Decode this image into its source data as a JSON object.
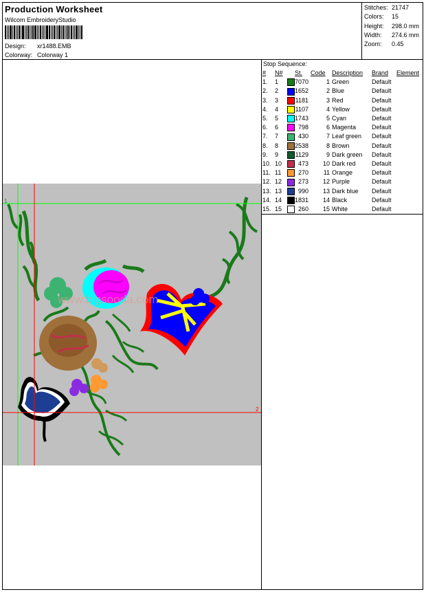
{
  "header": {
    "title": "Production Worksheet",
    "software": "Wilcom EmbroideryStudio",
    "design_label": "Design:",
    "design_value": "xr1488.EMB",
    "colorway_label": "Colorway:",
    "colorway_value": "Colorway 1"
  },
  "stats": {
    "stitches_label": "Stitches:",
    "stitches": "21747",
    "colors_label": "Colors:",
    "colors": "15",
    "height_label": "Height:",
    "height": "298.0 mm",
    "width_label": "Width:",
    "width": "274.6 mm",
    "zoom_label": "Zoom:",
    "zoom": "0.45"
  },
  "stop_sequence": {
    "title": "Stop Sequence:",
    "headers": [
      "#",
      "N#",
      "St.",
      "Code",
      "Description",
      "Brand",
      "Element"
    ],
    "rows": [
      {
        "n": "1.",
        "nn": "1",
        "color": "#1a7a1a",
        "st": "7070",
        "code": "1",
        "desc": "Green",
        "brand": "Default"
      },
      {
        "n": "2.",
        "nn": "2",
        "color": "#0000ff",
        "st": "1652",
        "code": "2",
        "desc": "Blue",
        "brand": "Default"
      },
      {
        "n": "3.",
        "nn": "3",
        "color": "#ff0000",
        "st": "1181",
        "code": "3",
        "desc": "Red",
        "brand": "Default"
      },
      {
        "n": "4.",
        "nn": "4",
        "color": "#ffff00",
        "st": "1107",
        "code": "4",
        "desc": "Yellow",
        "brand": "Default"
      },
      {
        "n": "5.",
        "nn": "5",
        "color": "#00ffff",
        "st": "1743",
        "code": "5",
        "desc": "Cyan",
        "brand": "Default"
      },
      {
        "n": "6.",
        "nn": "6",
        "color": "#ff00ff",
        "st": "798",
        "code": "6",
        "desc": "Magenta",
        "brand": "Default"
      },
      {
        "n": "7.",
        "nn": "7",
        "color": "#3cb371",
        "st": "430",
        "code": "7",
        "desc": "Leaf green",
        "brand": "Default"
      },
      {
        "n": "8.",
        "nn": "8",
        "color": "#a0703a",
        "st": "2538",
        "code": "8",
        "desc": "Brown",
        "brand": "Default"
      },
      {
        "n": "9.",
        "nn": "9",
        "color": "#0f5a2e",
        "st": "1129",
        "code": "9",
        "desc": "Dark green",
        "brand": "Default"
      },
      {
        "n": "10.",
        "nn": "10",
        "color": "#c0304a",
        "st": "473",
        "code": "10",
        "desc": "Dark red",
        "brand": "Default"
      },
      {
        "n": "11.",
        "nn": "11",
        "color": "#ff9933",
        "st": "270",
        "code": "11",
        "desc": "Orange",
        "brand": "Default"
      },
      {
        "n": "12.",
        "nn": "12",
        "color": "#8a2be2",
        "st": "273",
        "code": "12",
        "desc": "Purple",
        "brand": "Default"
      },
      {
        "n": "13.",
        "nn": "13",
        "color": "#1c3f94",
        "st": "990",
        "code": "13",
        "desc": "Dark blue",
        "brand": "Default"
      },
      {
        "n": "14.",
        "nn": "14",
        "color": "#000000",
        "st": "1831",
        "code": "14",
        "desc": "Black",
        "brand": "Default"
      },
      {
        "n": "15.",
        "nn": "15",
        "color": "#ffffff",
        "st": "260",
        "code": "15",
        "desc": "White",
        "brand": "Default"
      }
    ]
  },
  "preview": {
    "marker_1": "1",
    "marker_2": "2",
    "watermark": "www.bigsooda.com"
  }
}
